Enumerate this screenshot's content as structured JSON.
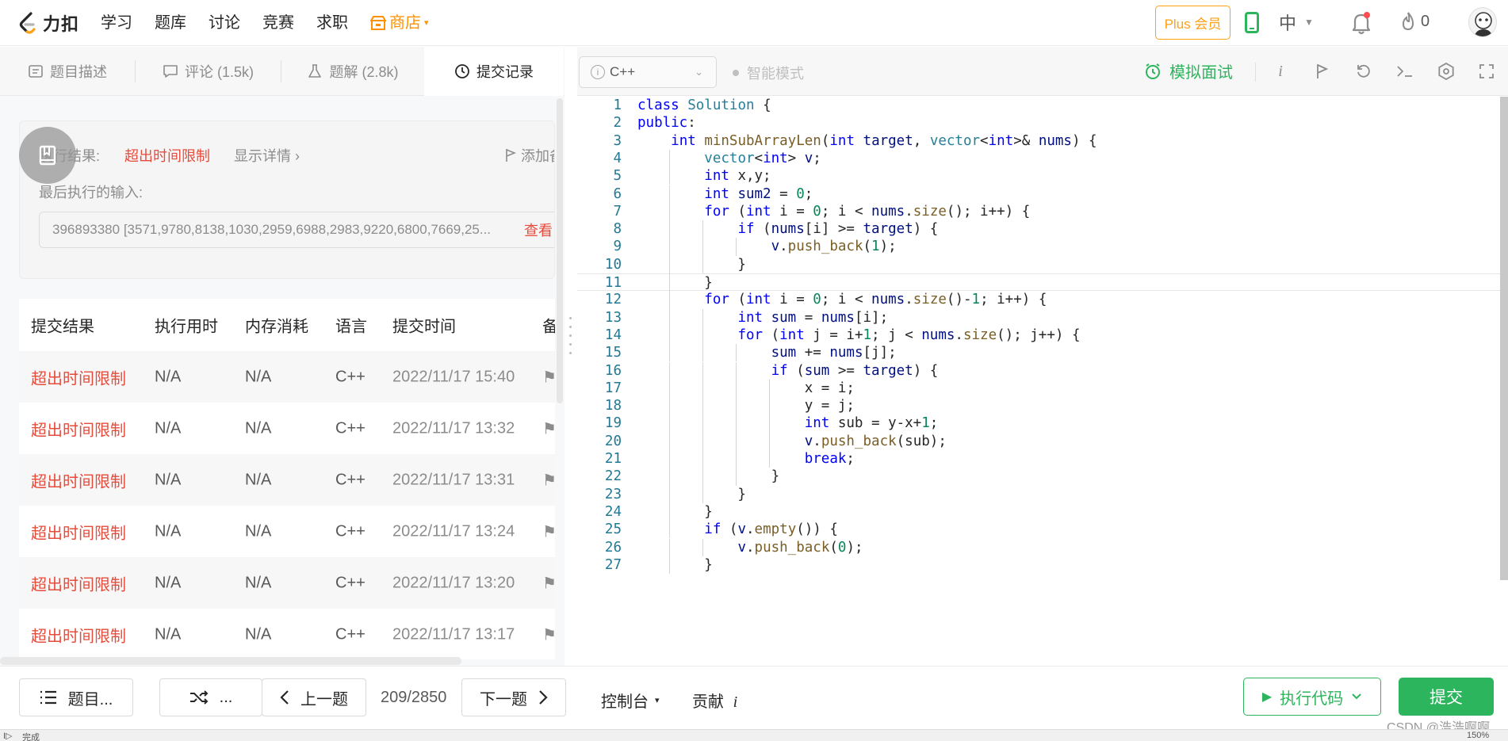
{
  "nav": {
    "logo_text": "力扣",
    "items": [
      "学习",
      "题库",
      "讨论",
      "竞赛",
      "求职"
    ],
    "store": "商店",
    "plus": "Plus 会员",
    "lang": "中",
    "fire_count": "0"
  },
  "tabs": [
    {
      "label": "题目描述"
    },
    {
      "label": "评论 (1.5k)"
    },
    {
      "label": "题解 (2.8k)"
    },
    {
      "label": "提交记录"
    }
  ],
  "result": {
    "label": "执行结果:",
    "status": "超出时间限制",
    "detail": "显示详情 ›",
    "add_note": "添加备注",
    "last_input_label": "最后执行的输入:",
    "last_input": "396893380 [3571,9780,8138,1030,2959,6988,2983,9220,6800,7669,25...",
    "view": "查看"
  },
  "table": {
    "headers": [
      "提交结果",
      "执行用时",
      "内存消耗",
      "语言",
      "提交时间",
      "备注"
    ],
    "rows": [
      {
        "result": "超出时间限制",
        "time": "N/A",
        "mem": "N/A",
        "lang": "C++",
        "date": "2022/11/17 15:40"
      },
      {
        "result": "超出时间限制",
        "time": "N/A",
        "mem": "N/A",
        "lang": "C++",
        "date": "2022/11/17 13:32"
      },
      {
        "result": "超出时间限制",
        "time": "N/A",
        "mem": "N/A",
        "lang": "C++",
        "date": "2022/11/17 13:31"
      },
      {
        "result": "超出时间限制",
        "time": "N/A",
        "mem": "N/A",
        "lang": "C++",
        "date": "2022/11/17 13:24"
      },
      {
        "result": "超出时间限制",
        "time": "N/A",
        "mem": "N/A",
        "lang": "C++",
        "date": "2022/11/17 13:20"
      },
      {
        "result": "超出时间限制",
        "time": "N/A",
        "mem": "N/A",
        "lang": "C++",
        "date": "2022/11/17 13:17"
      }
    ]
  },
  "editor": {
    "language": "C++",
    "smart_mode": "智能模式",
    "mock_interview": "模拟面试",
    "current_line": 11,
    "lines": [
      "class Solution {",
      "public:",
      "    int minSubArrayLen(int target, vector<int>& nums) {",
      "        vector<int> v;",
      "        int x,y;",
      "        int sum2 = 0;",
      "        for (int i = 0; i < nums.size(); i++) {",
      "            if (nums[i] >= target) {",
      "                v.push_back(1);",
      "            }",
      "        }",
      "        for (int i = 0; i < nums.size()-1; i++) {",
      "            int sum = nums[i];",
      "            for (int j = i+1; j < nums.size(); j++) {",
      "                sum += nums[j];",
      "                if (sum >= target) {",
      "                    x = i;",
      "                    y = j;",
      "                    int sub = y-x+1;",
      "                    v.push_back(sub);",
      "                    break;",
      "                }",
      "            }",
      "        }",
      "        if (v.empty()) {",
      "            v.push_back(0);",
      "        }"
    ]
  },
  "bottom": {
    "problem_list": "题目...",
    "random": "...",
    "prev": "上一题",
    "pager": "209/2850",
    "next": "下一题",
    "console": "控制台",
    "contribute": "贡献",
    "run": "执行代码",
    "submit": "提交"
  },
  "status": {
    "done": "完成",
    "watermark": "CSDN @浩浩啊啊",
    "zoom": "150%"
  },
  "colors": {
    "accent_green": "#2db55d",
    "error_red": "#e64c3c",
    "plus_orange": "#ffa116"
  }
}
